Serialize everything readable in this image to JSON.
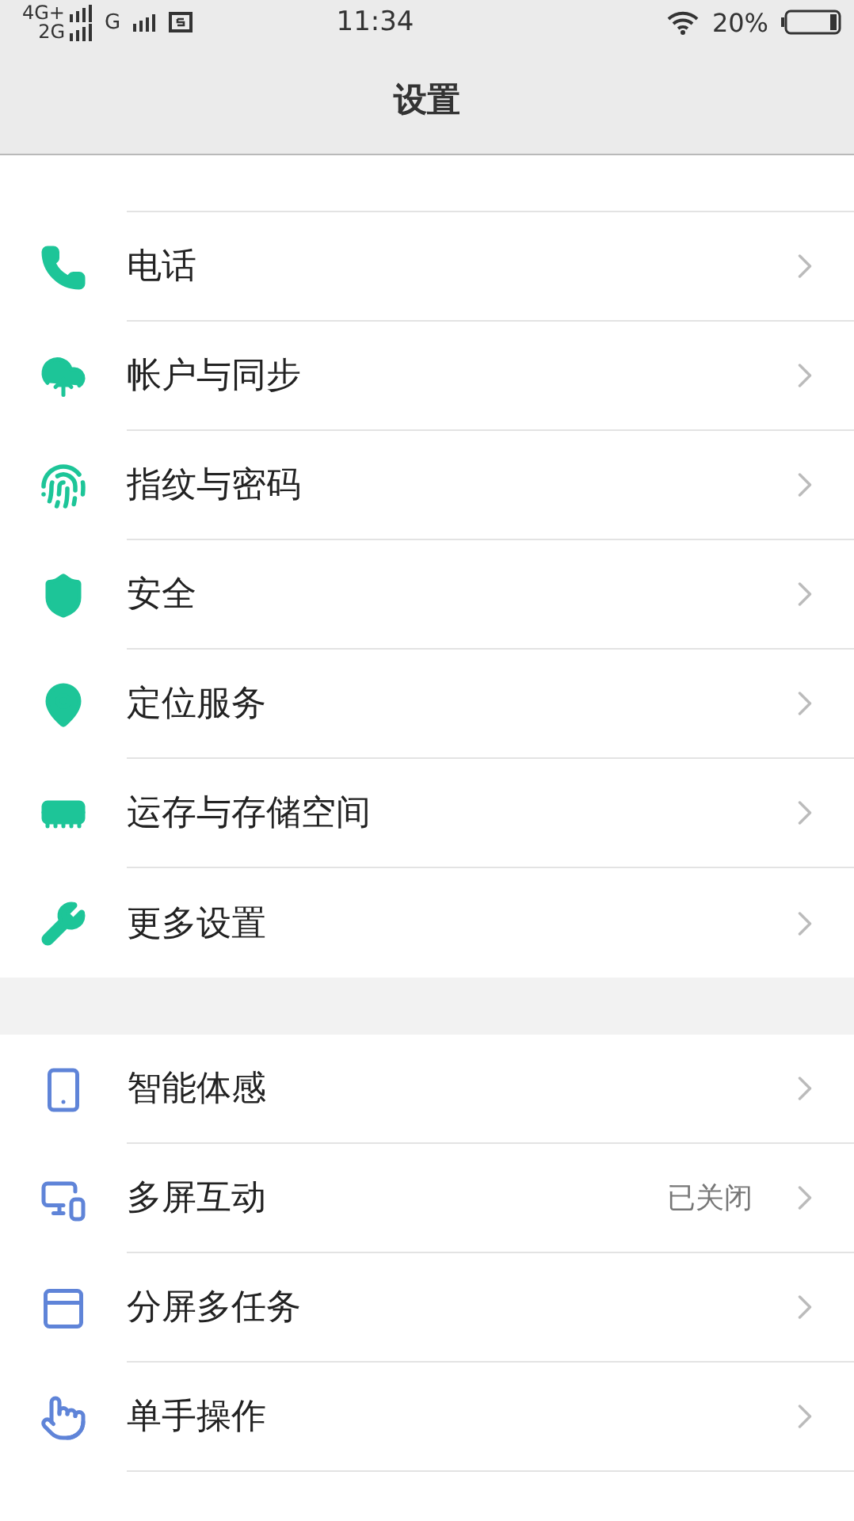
{
  "status_bar": {
    "network_1": "4G+",
    "network_2": "2G",
    "network_3": "G",
    "time": "11:34",
    "battery": "20%"
  },
  "header": {
    "title": "设置"
  },
  "sections": [
    {
      "items": [
        {
          "label": "电话"
        },
        {
          "label": "帐户与同步"
        },
        {
          "label": "指纹与密码"
        },
        {
          "label": "安全"
        },
        {
          "label": "定位服务"
        },
        {
          "label": "运存与存储空间"
        },
        {
          "label": "更多设置"
        }
      ]
    },
    {
      "items": [
        {
          "label": "智能体感"
        },
        {
          "label": "多屏互动",
          "value": "已关闭"
        },
        {
          "label": "分屏多任务"
        },
        {
          "label": "单手操作"
        }
      ]
    }
  ]
}
